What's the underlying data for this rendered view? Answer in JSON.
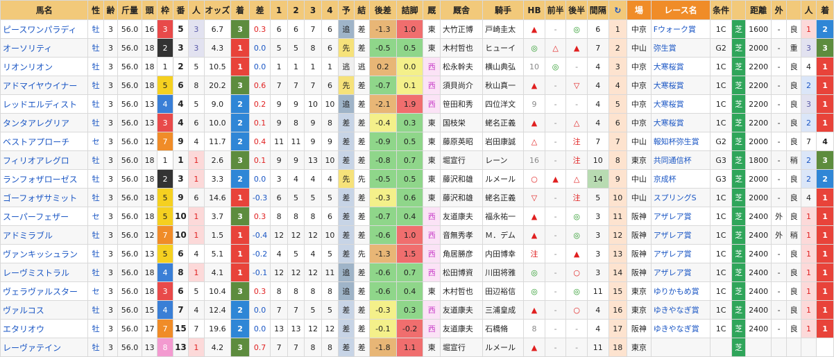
{
  "headers": [
    "馬名",
    "性",
    "齢",
    "斤量",
    "頭",
    "枠",
    "番",
    "人",
    "オッズ",
    "着",
    "差",
    "1",
    "2",
    "3",
    "4",
    "予",
    "結",
    "後差",
    "詰脚",
    "厩",
    "厩舎",
    "騎手",
    "HB",
    "前半",
    "後半",
    "間隔",
    "↻",
    "場",
    "レース名",
    "条件",
    "",
    "距離",
    "外",
    "",
    "人",
    "着"
  ],
  "rows": [
    {
      "name": "ピースワンパラディ",
      "sex": "牡",
      "age": "3",
      "weight": "56.0",
      "heads": "16",
      "waku": "3",
      "ban": "5",
      "pop": "3",
      "odds": "6.7",
      "pchaku": "3",
      "diff": "0.3",
      "c1": "6",
      "c2": "6",
      "c3": "7",
      "c4": "6",
      "yo": "追",
      "ke": "差",
      "ato": "-1.3",
      "tsume": "1.0",
      "stable": "東",
      "trainer": "大竹正博",
      "jockey": "戸崎圭太",
      "hb": "▲",
      "zen": "-",
      "kou": "◎",
      "intv": "6",
      "count": "1",
      "place": "中京",
      "race": "Fウォーク賞",
      "cond": "1C",
      "surf": "芝",
      "dist": "1600",
      "out": "-",
      "baba": "良",
      "rpop": "1",
      "rchaku": "2"
    },
    {
      "name": "オーソリティ",
      "sex": "牡",
      "age": "3",
      "weight": "56.0",
      "heads": "18",
      "waku": "2",
      "ban": "3",
      "pop": "3",
      "odds": "4.3",
      "pchaku": "1",
      "diff": "0.0",
      "c1": "5",
      "c2": "5",
      "c3": "8",
      "c4": "6",
      "yo": "先",
      "ke": "差",
      "ato": "-0.5",
      "tsume": "0.5",
      "stable": "東",
      "trainer": "木村哲也",
      "jockey": "ヒューイ",
      "hb": "◎",
      "zen": "△",
      "kou": "▲",
      "intv": "7",
      "count": "2",
      "place": "中山",
      "race": "弥生賞",
      "cond": "G2",
      "surf": "芝",
      "dist": "2000",
      "out": "-",
      "baba": "重",
      "rpop": "3",
      "rchaku": "3"
    },
    {
      "name": "リオンリオン",
      "sex": "牡",
      "age": "3",
      "weight": "56.0",
      "heads": "18",
      "waku": "1",
      "ban": "2",
      "pop": "5",
      "odds": "10.5",
      "pchaku": "1",
      "diff": "0.0",
      "c1": "1",
      "c2": "1",
      "c3": "1",
      "c4": "1",
      "yo": "逃",
      "ke": "逃",
      "ato": "0.2",
      "tsume": "0.0",
      "stable": "西",
      "trainer": "松永幹夫",
      "jockey": "横山典弘",
      "hb": "10",
      "zen": "◎",
      "kou": "-",
      "intv": "4",
      "count": "3",
      "place": "中京",
      "race": "大寒桜賞",
      "cond": "1C",
      "surf": "芝",
      "dist": "2200",
      "out": "-",
      "baba": "良",
      "rpop": "4",
      "rchaku": "1"
    },
    {
      "name": "アドマイヤウイナー",
      "sex": "牡",
      "age": "3",
      "weight": "56.0",
      "heads": "18",
      "waku": "5",
      "ban": "6",
      "pop": "8",
      "odds": "20.2",
      "pchaku": "3",
      "diff": "0.6",
      "c1": "7",
      "c2": "7",
      "c3": "7",
      "c4": "6",
      "yo": "先",
      "ke": "差",
      "ato": "-0.7",
      "tsume": "0.1",
      "stable": "西",
      "trainer": "須貝尚介",
      "jockey": "秋山真一",
      "hb": "▲",
      "zen": "-",
      "kou": "▽",
      "intv": "4",
      "count": "4",
      "place": "中京",
      "race": "大寒桜賞",
      "cond": "1C",
      "surf": "芝",
      "dist": "2200",
      "out": "-",
      "baba": "良",
      "rpop": "2",
      "rchaku": "1"
    },
    {
      "name": "レッドエルディスト",
      "sex": "牡",
      "age": "3",
      "weight": "56.0",
      "heads": "13",
      "waku": "4",
      "ban": "4",
      "pop": "5",
      "odds": "9.0",
      "pchaku": "2",
      "diff": "0.2",
      "c1": "9",
      "c2": "9",
      "c3": "10",
      "c4": "10",
      "yo": "追",
      "ke": "差",
      "ato": "-2.1",
      "tsume": "1.9",
      "stable": "西",
      "trainer": "笹田和秀",
      "jockey": "四位洋文",
      "hb": "9",
      "zen": "-",
      "kou": "-",
      "intv": "4",
      "count": "5",
      "place": "中京",
      "race": "大寒桜賞",
      "cond": "1C",
      "surf": "芝",
      "dist": "2200",
      "out": "-",
      "baba": "良",
      "rpop": "3",
      "rchaku": "1"
    },
    {
      "name": "タンタアレグリア",
      "sex": "牡",
      "age": "3",
      "weight": "56.0",
      "heads": "13",
      "waku": "3",
      "ban": "4",
      "pop": "6",
      "odds": "10.0",
      "pchaku": "2",
      "diff": "0.1",
      "c1": "9",
      "c2": "8",
      "c3": "9",
      "c4": "8",
      "yo": "差",
      "ke": "差",
      "ato": "-0.4",
      "tsume": "0.3",
      "stable": "東",
      "trainer": "国枝栄",
      "jockey": "蛯名正義",
      "hb": "▲",
      "zen": "-",
      "kou": "△",
      "intv": "4",
      "count": "6",
      "place": "中京",
      "race": "大寒桜賞",
      "cond": "1C",
      "surf": "芝",
      "dist": "2200",
      "out": "-",
      "baba": "良",
      "rpop": "2",
      "rchaku": "1"
    },
    {
      "name": "ベストアプローチ",
      "sex": "セ",
      "age": "3",
      "weight": "56.0",
      "heads": "12",
      "waku": "7",
      "ban": "9",
      "pop": "4",
      "odds": "11.7",
      "pchaku": "2",
      "diff": "0.4",
      "c1": "11",
      "c2": "11",
      "c3": "9",
      "c4": "9",
      "yo": "差",
      "ke": "差",
      "ato": "-0.9",
      "tsume": "0.5",
      "stable": "東",
      "trainer": "藤原英昭",
      "jockey": "岩田康誠",
      "hb": "△",
      "zen": "-",
      "kou": "注",
      "intv": "7",
      "count": "7",
      "place": "中山",
      "race": "報知杯弥生賞",
      "cond": "G2",
      "surf": "芝",
      "dist": "2000",
      "out": "-",
      "baba": "良",
      "rpop": "7",
      "rchaku": "4"
    },
    {
      "name": "フィリオアレグロ",
      "sex": "牡",
      "age": "3",
      "weight": "56.0",
      "heads": "18",
      "waku": "1",
      "ban": "1",
      "pop": "1",
      "odds": "2.6",
      "pchaku": "3",
      "diff": "0.1",
      "c1": "9",
      "c2": "9",
      "c3": "13",
      "c4": "10",
      "yo": "差",
      "ke": "差",
      "ato": "-0.8",
      "tsume": "0.7",
      "stable": "東",
      "trainer": "堀宣行",
      "jockey": "レーン",
      "hb": "16",
      "zen": "-",
      "kou": "注",
      "intv": "10",
      "count": "8",
      "place": "東京",
      "race": "共同通信杯",
      "cond": "G3",
      "surf": "芝",
      "dist": "1800",
      "out": "-",
      "baba": "稍",
      "rpop": "2",
      "rchaku": "3"
    },
    {
      "name": "ランフォザローゼス",
      "sex": "牡",
      "age": "3",
      "weight": "56.0",
      "heads": "18",
      "waku": "2",
      "ban": "3",
      "pop": "1",
      "odds": "3.3",
      "pchaku": "2",
      "diff": "0.0",
      "c1": "3",
      "c2": "4",
      "c3": "4",
      "c4": "4",
      "yo": "先",
      "ke": "先",
      "ato": "-0.5",
      "tsume": "0.5",
      "stable": "東",
      "trainer": "藤沢和雄",
      "jockey": "ルメール",
      "hb": "○",
      "zen": "▲",
      "kou": "△",
      "intv": "14",
      "count": "9",
      "place": "中山",
      "race": "京成杯",
      "cond": "G3",
      "surf": "芝",
      "dist": "2000",
      "out": "-",
      "baba": "良",
      "rpop": "2",
      "rchaku": "2"
    },
    {
      "name": "ゴーフォザサミット",
      "sex": "牡",
      "age": "3",
      "weight": "56.0",
      "heads": "18",
      "waku": "5",
      "ban": "9",
      "pop": "6",
      "odds": "14.6",
      "pchaku": "1",
      "diff": "-0.3",
      "c1": "6",
      "c2": "5",
      "c3": "5",
      "c4": "5",
      "yo": "差",
      "ke": "差",
      "ato": "-0.3",
      "tsume": "0.6",
      "stable": "東",
      "trainer": "藤沢和雄",
      "jockey": "蛯名正義",
      "hb": "▽",
      "zen": "-",
      "kou": "注",
      "intv": "5",
      "count": "10",
      "place": "中山",
      "race": "スプリングS",
      "cond": "1C",
      "surf": "芝",
      "dist": "2000",
      "out": "-",
      "baba": "良",
      "rpop": "4",
      "rchaku": "1"
    },
    {
      "name": "スーパーフェザー",
      "sex": "セ",
      "age": "3",
      "weight": "56.0",
      "heads": "18",
      "waku": "5",
      "ban": "10",
      "pop": "1",
      "odds": "3.7",
      "pchaku": "3",
      "diff": "0.3",
      "c1": "8",
      "c2": "8",
      "c3": "8",
      "c4": "6",
      "yo": "差",
      "ke": "差",
      "ato": "-0.7",
      "tsume": "0.4",
      "stable": "西",
      "trainer": "友道康夫",
      "jockey": "福永祐一",
      "hb": "▲",
      "zen": "-",
      "kou": "◎",
      "intv": "3",
      "count": "11",
      "place": "阪神",
      "race": "アザレア賞",
      "cond": "1C",
      "surf": "芝",
      "dist": "2400",
      "out": "外",
      "baba": "良",
      "rpop": "1",
      "rchaku": "1"
    },
    {
      "name": "アドミラブル",
      "sex": "牡",
      "age": "3",
      "weight": "56.0",
      "heads": "12",
      "waku": "7",
      "ban": "10",
      "pop": "1",
      "odds": "1.5",
      "pchaku": "1",
      "diff": "-0.4",
      "c1": "12",
      "c2": "12",
      "c3": "12",
      "c4": "10",
      "yo": "差",
      "ke": "差",
      "ato": "-0.6",
      "tsume": "1.0",
      "stable": "西",
      "trainer": "音無秀孝",
      "jockey": "Ｍ．デム",
      "hb": "▲",
      "zen": "-",
      "kou": "◎",
      "intv": "3",
      "count": "12",
      "place": "阪神",
      "race": "アザレア賞",
      "cond": "1C",
      "surf": "芝",
      "dist": "2400",
      "out": "外",
      "baba": "稍",
      "rpop": "1",
      "rchaku": "1"
    },
    {
      "name": "ヴァンキッシュラン",
      "sex": "牡",
      "age": "3",
      "weight": "56.0",
      "heads": "13",
      "waku": "5",
      "ban": "6",
      "pop": "4",
      "odds": "5.1",
      "pchaku": "1",
      "diff": "-0.2",
      "c1": "4",
      "c2": "5",
      "c3": "4",
      "c4": "5",
      "yo": "差",
      "ke": "先",
      "ato": "-1.3",
      "tsume": "1.5",
      "stable": "西",
      "trainer": "角居勝彦",
      "jockey": "内田博幸",
      "hb": "注",
      "zen": "-",
      "kou": "▲",
      "intv": "3",
      "count": "13",
      "place": "阪神",
      "race": "アザレア賞",
      "cond": "1C",
      "surf": "芝",
      "dist": "2400",
      "out": "-",
      "baba": "良",
      "rpop": "1",
      "rchaku": "1"
    },
    {
      "name": "レーヴミストラル",
      "sex": "牡",
      "age": "3",
      "weight": "56.0",
      "heads": "18",
      "waku": "4",
      "ban": "8",
      "pop": "1",
      "odds": "4.1",
      "pchaku": "1",
      "diff": "-0.1",
      "c1": "12",
      "c2": "12",
      "c3": "12",
      "c4": "11",
      "yo": "追",
      "ke": "差",
      "ato": "-0.6",
      "tsume": "0.7",
      "stable": "西",
      "trainer": "松田博資",
      "jockey": "川田将雅",
      "hb": "◎",
      "zen": "-",
      "kou": "○",
      "intv": "3",
      "count": "14",
      "place": "阪神",
      "race": "アザレア賞",
      "cond": "1C",
      "surf": "芝",
      "dist": "2400",
      "out": "-",
      "baba": "良",
      "rpop": "1",
      "rchaku": "1"
    },
    {
      "name": "ヴェラヴァルスター",
      "sex": "セ",
      "age": "3",
      "weight": "56.0",
      "heads": "18",
      "waku": "3",
      "ban": "6",
      "pop": "5",
      "odds": "10.4",
      "pchaku": "3",
      "diff": "0.3",
      "c1": "8",
      "c2": "8",
      "c3": "8",
      "c4": "8",
      "yo": "追",
      "ke": "差",
      "ato": "-0.6",
      "tsume": "0.4",
      "stable": "東",
      "trainer": "木村哲也",
      "jockey": "田辺裕信",
      "hb": "◎",
      "zen": "-",
      "kou": "◎",
      "intv": "11",
      "count": "15",
      "place": "東京",
      "race": "ゆりかもめ賞",
      "cond": "1C",
      "surf": "芝",
      "dist": "2400",
      "out": "-",
      "baba": "良",
      "rpop": "1",
      "rchaku": "1"
    },
    {
      "name": "ヴァルコス",
      "sex": "牡",
      "age": "3",
      "weight": "56.0",
      "heads": "15",
      "waku": "4",
      "ban": "7",
      "pop": "4",
      "odds": "12.4",
      "pchaku": "2",
      "diff": "0.0",
      "c1": "7",
      "c2": "7",
      "c3": "5",
      "c4": "5",
      "yo": "差",
      "ke": "差",
      "ato": "-0.3",
      "tsume": "0.3",
      "stable": "西",
      "trainer": "友道康夫",
      "jockey": "三浦皇成",
      "hb": "▲",
      "zen": "-",
      "kou": "○",
      "intv": "4",
      "count": "16",
      "place": "東京",
      "race": "ゆきやなぎ賞",
      "cond": "1C",
      "surf": "芝",
      "dist": "2400",
      "out": "-",
      "baba": "良",
      "rpop": "1",
      "rchaku": "1"
    },
    {
      "name": "エタリオウ",
      "sex": "牡",
      "age": "3",
      "weight": "56.0",
      "heads": "17",
      "waku": "7",
      "ban": "15",
      "pop": "7",
      "odds": "19.6",
      "pchaku": "2",
      "diff": "0.0",
      "c1": "13",
      "c2": "13",
      "c3": "12",
      "c4": "12",
      "yo": "差",
      "ke": "差",
      "ato": "-0.1",
      "tsume": "-0.2",
      "stable": "西",
      "trainer": "友道康夫",
      "jockey": "石橋脩",
      "hb": "8",
      "zen": "-",
      "kou": "-",
      "intv": "4",
      "count": "17",
      "place": "阪神",
      "race": "ゆきやなぎ賞",
      "cond": "1C",
      "surf": "芝",
      "dist": "2400",
      "out": "-",
      "baba": "良",
      "rpop": "1",
      "rchaku": "1"
    },
    {
      "name": "レーヴァテイン",
      "sex": "牡",
      "age": "3",
      "weight": "56.0",
      "heads": "13",
      "waku": "8",
      "ban": "13",
      "pop": "1",
      "odds": "4.2",
      "pchaku": "3",
      "diff": "0.7",
      "c1": "7",
      "c2": "7",
      "c3": "8",
      "c4": "8",
      "yo": "差",
      "ke": "差",
      "ato": "-1.8",
      "tsume": "1.1",
      "stable": "東",
      "trainer": "堀宣行",
      "jockey": "ルメール",
      "hb": "▲",
      "zen": "-",
      "kou": "-",
      "intv": "11",
      "count": "18",
      "place": "東京",
      "race": "",
      "cond": "",
      "surf": "芝",
      "dist": "",
      "out": "",
      "baba": "",
      "rpop": "",
      "rchaku": ""
    }
  ]
}
